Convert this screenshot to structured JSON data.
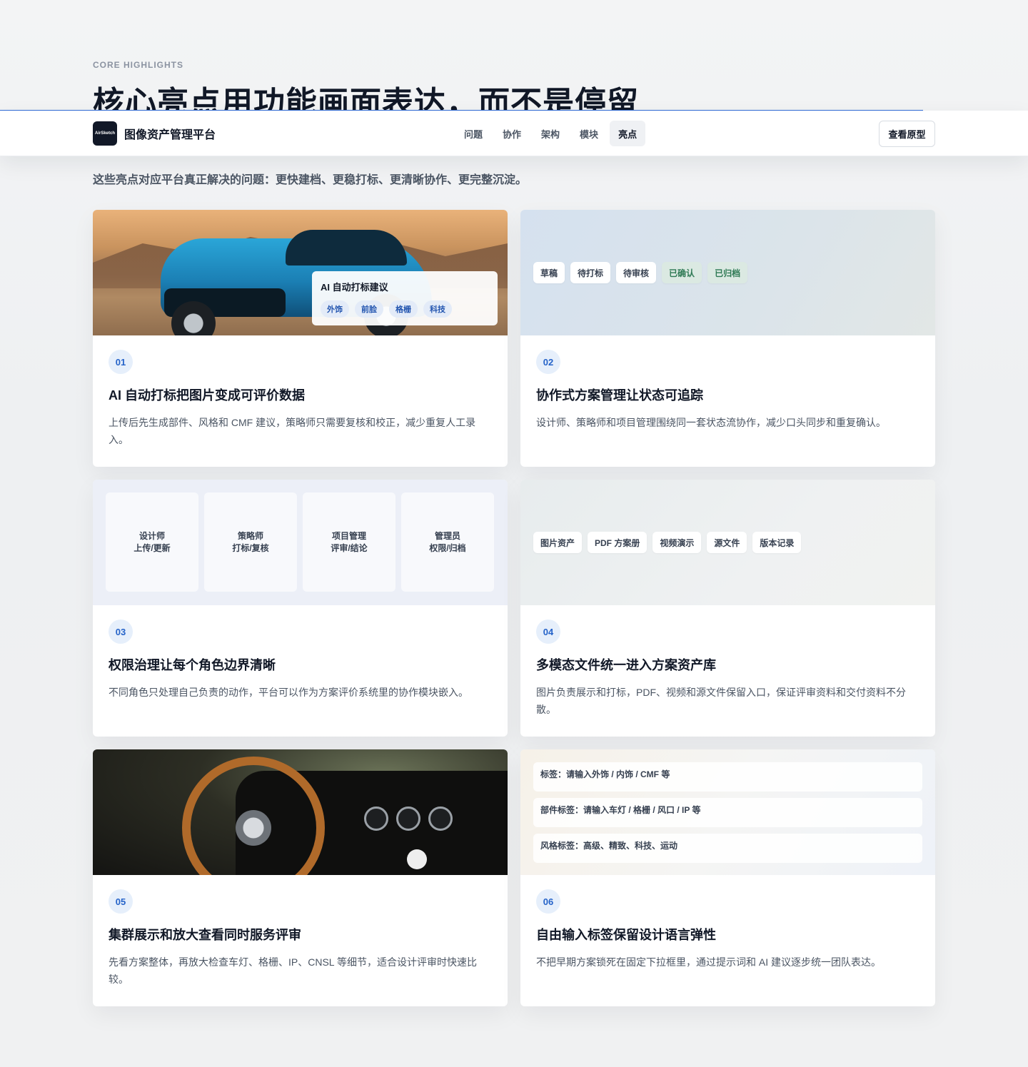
{
  "hero": {
    "eyebrow": "CORE HIGHLIGHTS",
    "title": "核心亮点用功能画面表达，而不是停留",
    "subtitle": "这些亮点对应平台真正解决的问题：更快建档、更稳打标、更清晰协作、更完整沉淀。"
  },
  "nav": {
    "logo_text": "AirSketch",
    "brand": "图像资产管理平台",
    "links": [
      "问题",
      "协作",
      "架构",
      "模块",
      "亮点"
    ],
    "active_link": "亮点",
    "cta": "查看原型"
  },
  "cards": [
    {
      "num": "01",
      "title": "AI 自动打标把图片变成可评价数据",
      "desc": "上传后先生成部件、风格和 CMF 建议，策略师只需要复核和校正，减少重复人工录入。",
      "overlay_title": "AI 自动打标建议",
      "overlay_tags": [
        "外饰",
        "前脸",
        "格栅",
        "科技"
      ]
    },
    {
      "num": "02",
      "title": "协作式方案管理让状态可追踪",
      "desc": "设计师、策略师和项目管理围绕同一套状态流协作，减少口头同步和重复确认。",
      "chips": [
        "草稿",
        "待打标",
        "待审核",
        "已确认",
        "已归档"
      ]
    },
    {
      "num": "03",
      "title": "权限治理让每个角色边界清晰",
      "desc": "不同角色只处理自己负责的动作，平台可以作为方案评价系统里的协作模块嵌入。",
      "roles": [
        {
          "name": "设计师",
          "action": "上传/更新"
        },
        {
          "name": "策略师",
          "action": "打标/复核"
        },
        {
          "name": "项目管理",
          "action": "评审/结论"
        },
        {
          "name": "管理员",
          "action": "权限/归档"
        }
      ]
    },
    {
      "num": "04",
      "title": "多模态文件统一进入方案资产库",
      "desc": "图片负责展示和打标，PDF、视频和源文件保留入口，保证评审资料和交付资料不分散。",
      "chips": [
        "图片资产",
        "PDF 方案册",
        "视频演示",
        "源文件",
        "版本记录"
      ]
    },
    {
      "num": "05",
      "title": "集群展示和放大查看同时服务评审",
      "desc": "先看方案整体，再放大检查车灯、格栅、IP、CNSL 等细节，适合设计评审时快速比较。"
    },
    {
      "num": "06",
      "title": "自由输入标签保留设计语言弹性",
      "desc": "不把早期方案锁死在固定下拉框里，通过提示词和 AI 建议逐步统一团队表达。",
      "fields": [
        "标签：请输入外饰 / 内饰 / CMF 等",
        "部件标签：请输入车灯 / 格栅 / 风口 / IP 等",
        "风格标签：高级、精致、科技、运动"
      ]
    }
  ]
}
